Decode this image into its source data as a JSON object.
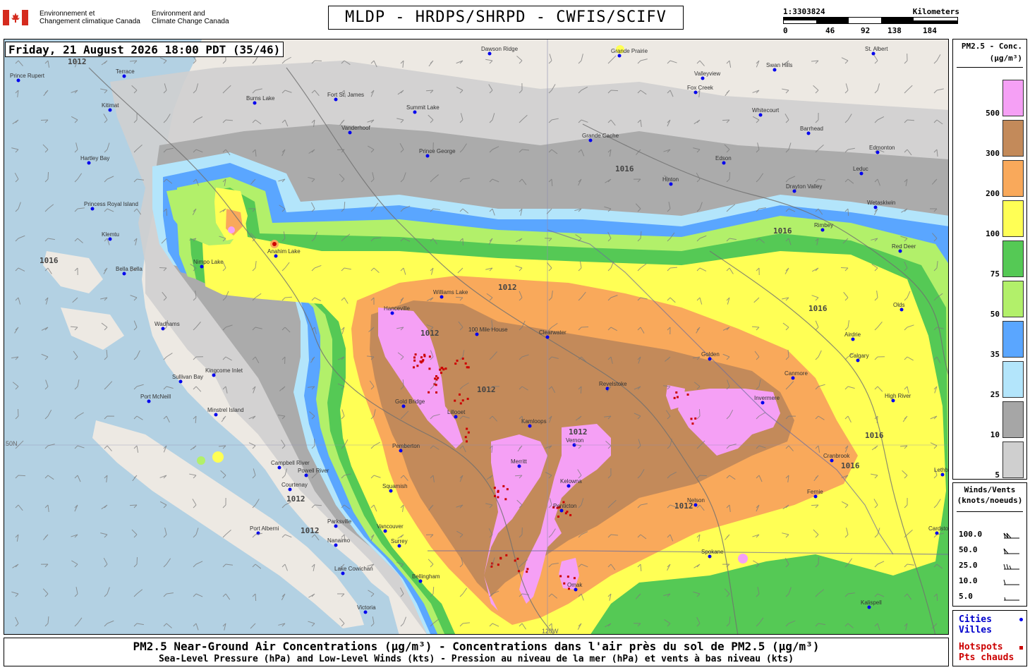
{
  "header": {
    "agency_fr_line1": "Environnement et",
    "agency_fr_line2": "Changement climatique Canada",
    "agency_en_line1": "Environment and",
    "agency_en_line2": "Climate Change Canada",
    "title": "MLDP - HRDPS/SHRPD - CWFIS/SCIFV"
  },
  "scale": {
    "ratio": "1:3303824",
    "unit": "Kilometers",
    "ticks": [
      "0",
      "46",
      "92",
      "138",
      "184"
    ]
  },
  "map": {
    "datetime": "Friday, 21 August 2026 18:00 PDT (35/46)",
    "isobar_labels": [
      "1012",
      "1016"
    ],
    "edge_labels": [
      "50N",
      "120W"
    ],
    "cities": [
      {
        "name": "Prince Rupert"
      },
      {
        "name": "Terrace"
      },
      {
        "name": "Kitimat"
      },
      {
        "name": "Hartley Bay"
      },
      {
        "name": "Princess Royal Island"
      },
      {
        "name": "Klemtu"
      },
      {
        "name": "Bella Bella"
      },
      {
        "name": "Wadhams"
      },
      {
        "name": "Sullivan Bay"
      },
      {
        "name": "Kingcome Inlet"
      },
      {
        "name": "Port McNeill"
      },
      {
        "name": "Minstrel Island"
      },
      {
        "name": "Campbell River"
      },
      {
        "name": "Powell River"
      },
      {
        "name": "Courtenay"
      },
      {
        "name": "Port Alberni"
      },
      {
        "name": "Parksville"
      },
      {
        "name": "Nanaimo"
      },
      {
        "name": "Lake Cowichan"
      },
      {
        "name": "Victoria"
      },
      {
        "name": "Vancouver"
      },
      {
        "name": "Surrey"
      },
      {
        "name": "Bellingham"
      },
      {
        "name": "Squamish"
      },
      {
        "name": "Pemberton"
      },
      {
        "name": "Gold Bridge"
      },
      {
        "name": "Lillooet"
      },
      {
        "name": "Kamloops"
      },
      {
        "name": "Merritt"
      },
      {
        "name": "Vernon"
      },
      {
        "name": "Kelowna"
      },
      {
        "name": "Penticton"
      },
      {
        "name": "Omak"
      },
      {
        "name": "Clearwater"
      },
      {
        "name": "100 Mile House"
      },
      {
        "name": "Williams Lake"
      },
      {
        "name": "Hanceville"
      },
      {
        "name": "Anahim Lake"
      },
      {
        "name": "Nimpo Lake"
      },
      {
        "name": "Revelstoke"
      },
      {
        "name": "Golden"
      },
      {
        "name": "Invermere"
      },
      {
        "name": "Canmore"
      },
      {
        "name": "Calgary"
      },
      {
        "name": "Airdrie"
      },
      {
        "name": "Olds"
      },
      {
        "name": "Red Deer"
      },
      {
        "name": "High River"
      },
      {
        "name": "Cranbrook"
      },
      {
        "name": "Nelson"
      },
      {
        "name": "Fernie"
      },
      {
        "name": "Lethbridge"
      },
      {
        "name": "Drayton Valley"
      },
      {
        "name": "Edmonton"
      },
      {
        "name": "Leduc"
      },
      {
        "name": "Wetaskiwin"
      },
      {
        "name": "Rimbey"
      },
      {
        "name": "Edson"
      },
      {
        "name": "Hinton"
      },
      {
        "name": "Grande Cache"
      },
      {
        "name": "Prince George"
      },
      {
        "name": "Summit Lake"
      },
      {
        "name": "Fort St. James"
      },
      {
        "name": "Vanderhoof"
      },
      {
        "name": "Burns Lake"
      },
      {
        "name": "Whitecourt"
      },
      {
        "name": "Barrhead"
      },
      {
        "name": "Swan Hills"
      },
      {
        "name": "Fox Creek"
      },
      {
        "name": "Grande Prairie"
      },
      {
        "name": "Valleyview"
      },
      {
        "name": "Dawson Ridge"
      },
      {
        "name": "St. Albert"
      },
      {
        "name": "Spokane"
      },
      {
        "name": "Kalispell"
      },
      {
        "name": "Cardston"
      }
    ]
  },
  "legend_pm": {
    "title_line1": "PM2.5 - Conc.",
    "title_line2": "(µg/m³)",
    "bins": [
      {
        "label": "500",
        "color": "#f5a0f5"
      },
      {
        "label": "300",
        "color": "#c38a5a"
      },
      {
        "label": "200",
        "color": "#f9a95b"
      },
      {
        "label": "100",
        "color": "#ffff55"
      },
      {
        "label": "75",
        "color": "#55c955"
      },
      {
        "label": "50",
        "color": "#b2f06a"
      },
      {
        "label": "35",
        "color": "#5aa6ff"
      },
      {
        "label": "25",
        "color": "#b3e5fb"
      },
      {
        "label": "10",
        "color": "#a6a6a6"
      },
      {
        "label": "5",
        "color": "#cfcfcf"
      }
    ]
  },
  "legend_wind": {
    "title_line1": "Winds/Vents",
    "title_line2": "(knots/noeuds)",
    "rows": [
      "100.0",
      "50.0",
      "25.0",
      "10.0",
      "5.0"
    ]
  },
  "legend_points": {
    "cities_en": "Cities",
    "cities_fr": "Villes",
    "hotspots_en": "Hotspots",
    "hotspots_fr": "Pts chauds",
    "city_color": "#0000ee",
    "hotspot_color": "#cc0000"
  },
  "footer": {
    "line1": "PM2.5 Near-Ground Air Concentrations (µg/m³) - Concentrations dans l'air près du sol de PM2.5 (µg/m³)",
    "line2": "Sea-Level Pressure (hPa) and Low-Level Winds (kts) - Pression au niveau de la mer (hPa) et vents à bas niveau (kts)"
  }
}
